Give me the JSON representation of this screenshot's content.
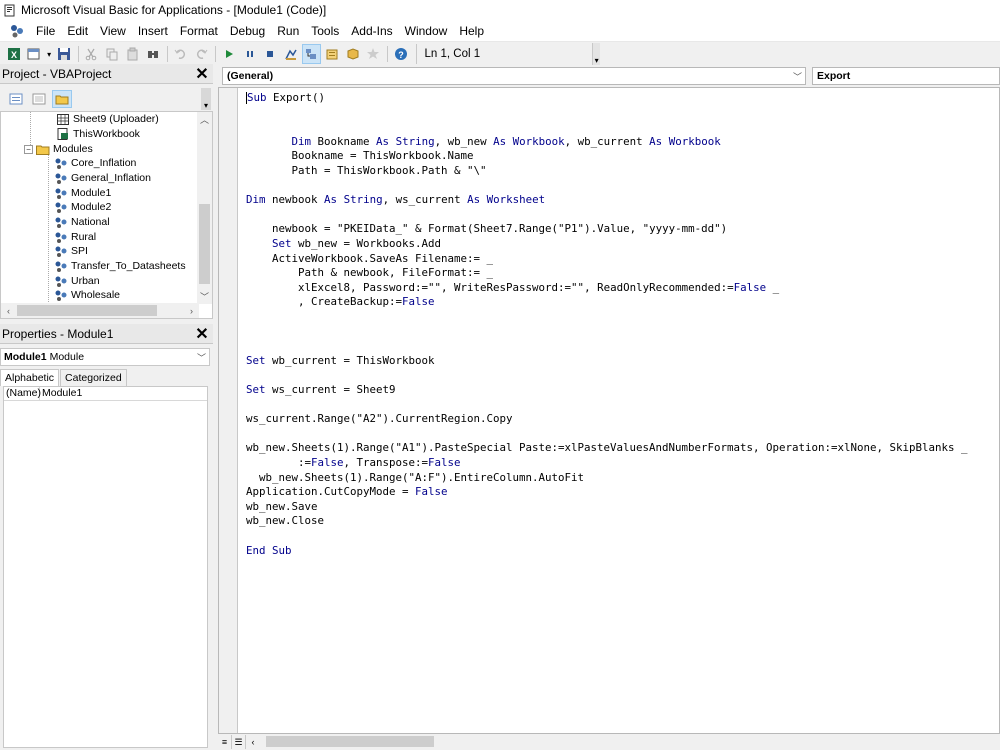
{
  "window": {
    "title": "Microsoft Visual Basic for Applications - [Module1 (Code)]"
  },
  "menu": [
    "File",
    "Edit",
    "View",
    "Insert",
    "Format",
    "Debug",
    "Run",
    "Tools",
    "Add-Ins",
    "Window",
    "Help"
  ],
  "toolbar": {
    "status": "Ln 1, Col 1"
  },
  "project_panel": {
    "title": "Project - VBAProject",
    "items": [
      {
        "label": "Sheet9 (Uploader)",
        "icon": "sheet-icon"
      },
      {
        "label": "ThisWorkbook",
        "icon": "workbook-icon"
      },
      {
        "label": "Modules",
        "icon": "folder-icon"
      },
      {
        "label": "Core_Inflation",
        "icon": "module-icon"
      },
      {
        "label": "General_Inflation",
        "icon": "module-icon"
      },
      {
        "label": "Module1",
        "icon": "module-icon"
      },
      {
        "label": "Module2",
        "icon": "module-icon"
      },
      {
        "label": "National",
        "icon": "module-icon"
      },
      {
        "label": "Rural",
        "icon": "module-icon"
      },
      {
        "label": "SPI",
        "icon": "module-icon"
      },
      {
        "label": "Transfer_To_Datasheets",
        "icon": "module-icon"
      },
      {
        "label": "Urban",
        "icon": "module-icon"
      },
      {
        "label": "Wholesale",
        "icon": "module-icon"
      }
    ]
  },
  "properties_panel": {
    "title": "Properties - Module1",
    "object_name": "Module1",
    "object_type": "Module",
    "tabs": [
      "Alphabetic",
      "Categorized"
    ],
    "rows": [
      {
        "key": "(Name)",
        "value": "Module1"
      }
    ]
  },
  "code_pane": {
    "object_combo": "(General)",
    "proc_combo": "Export",
    "lines": [
      "Sub Export()",
      "",
      "",
      "       Dim Bookname As String, wb_new As Workbook, wb_current As Workbook",
      "       Bookname = ThisWorkbook.Name",
      "       Path = ThisWorkbook.Path & \"\\\"",
      "",
      "Dim newbook As String, ws_current As Worksheet",
      "",
      "    newbook = \"PKEIData_\" & Format(Sheet7.Range(\"P1\").Value, \"yyyy-mm-dd\")",
      "    Set wb_new = Workbooks.Add",
      "    ActiveWorkbook.SaveAs Filename:= _",
      "        Path & newbook, FileFormat:= _",
      "        xlExcel8, Password:=\"\", WriteResPassword:=\"\", ReadOnlyRecommended:=False _",
      "        , CreateBackup:=False",
      "",
      "",
      "",
      "Set wb_current = ThisWorkbook",
      "",
      "Set ws_current = Sheet9",
      "",
      "ws_current.Range(\"A2\").CurrentRegion.Copy",
      "",
      "wb_new.Sheets(1).Range(\"A1\").PasteSpecial Paste:=xlPasteValuesAndNumberFormats, Operation:=xlNone, SkipBlanks _",
      "        :=False, Transpose:=False",
      "  wb_new.Sheets(1).Range(\"A:F\").EntireColumn.AutoFit",
      "Application.CutCopyMode = False",
      "wb_new.Save",
      "wb_new.Close",
      "",
      "End Sub"
    ]
  }
}
